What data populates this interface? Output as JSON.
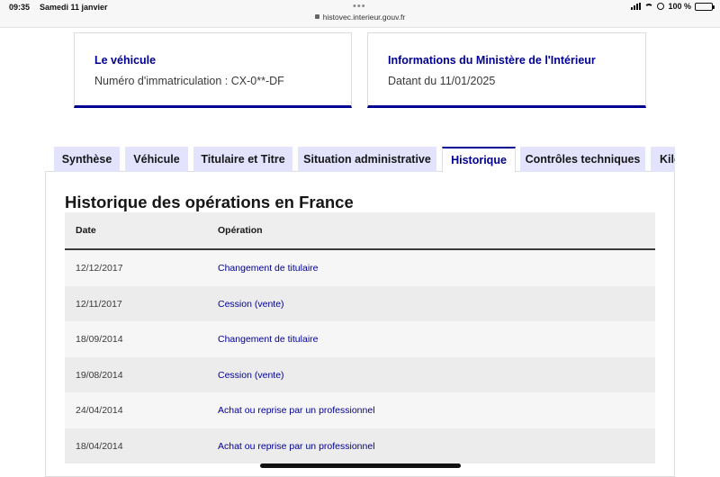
{
  "status_bar": {
    "time": "09:35",
    "date": "Samedi 11 janvier",
    "url": "histovec.interieur.gouv.fr",
    "battery": "100 %",
    "battery_level_pct": 100
  },
  "cards": [
    {
      "title": "Le véhicule",
      "text": "Numéro d'immatriculation : CX-0**-DF"
    },
    {
      "title": "Informations du Ministère de l'Intérieur",
      "text": "Datant du 11/01/2025"
    }
  ],
  "tabs": [
    {
      "label": "Synthèse"
    },
    {
      "label": "Véhicule"
    },
    {
      "label": "Titulaire et Titre"
    },
    {
      "label": "Situation administrative"
    },
    {
      "label": "Historique",
      "active": true
    },
    {
      "label": "Contrôles techniques"
    },
    {
      "label": "Kilométrage"
    }
  ],
  "main": {
    "heading": "Historique des opérations en France",
    "table": {
      "headers": [
        "Date",
        "Opération"
      ],
      "rows": [
        [
          "12/12/2017",
          "Changement de titulaire"
        ],
        [
          "12/11/2017",
          "Cession (vente)"
        ],
        [
          "18/09/2014",
          "Changement de titulaire"
        ],
        [
          "19/08/2014",
          "Cession (vente)"
        ],
        [
          "24/04/2014",
          "Achat ou reprise par un professionnel"
        ],
        [
          "18/04/2014",
          "Achat ou reprise par un professionnel"
        ]
      ]
    }
  },
  "colors": {
    "accent": "#000091",
    "tab_bg": "#e3e3fd"
  }
}
